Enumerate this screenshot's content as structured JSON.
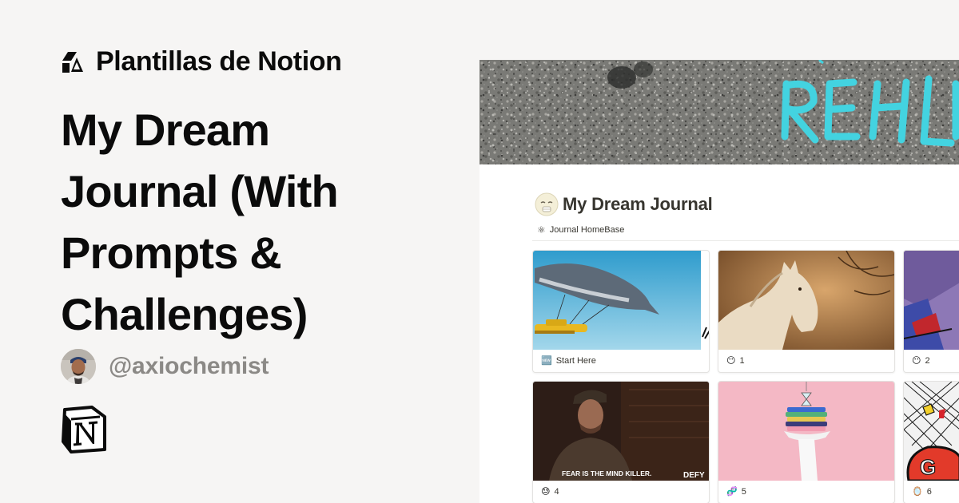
{
  "brand": {
    "name": "Plantillas de Notion",
    "logo_icon": "plantillas-logo-icon"
  },
  "template": {
    "title": "My Dream Journal (With Prompts & Challenges)"
  },
  "author": {
    "handle": "@axiochemist",
    "avatar_icon": "author-avatar"
  },
  "notion_logo_icon": "notion-logo-icon",
  "preview": {
    "page_title": "My Dream Journal",
    "page_icon": "sleepy-face-icon",
    "view_icon": "⚛",
    "view_label": "Journal HomeBase",
    "cards": [
      {
        "emoji": "🆕",
        "label": "Start Here",
        "image": "flying-whale-plane"
      },
      {
        "emoji": "😶",
        "label": "1",
        "image": "white-horse-sepia"
      },
      {
        "emoji": "😶",
        "label": "2",
        "image": "purple-cartoon"
      },
      {
        "emoji": "😓",
        "label": "4",
        "image": "man-fear-quote",
        "image_text": "FEAR IS THE MIND KILLER.",
        "image_logo": "DEFY"
      },
      {
        "emoji": "🧬",
        "label": "5",
        "image": "hand-with-towels-hourglass"
      },
      {
        "emoji": "🪞",
        "label": "6",
        "image": "comic-graffiti"
      }
    ]
  },
  "colors": {
    "background": "#f6f5f4",
    "text": "#0b0b0b",
    "muted": "#8b8986",
    "graffiti": "#43d3e0"
  }
}
